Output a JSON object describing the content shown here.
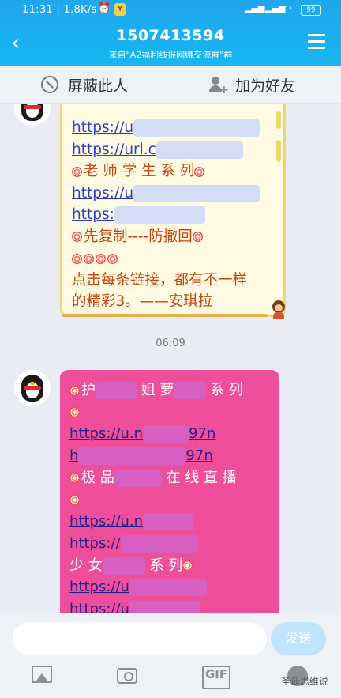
{
  "status_bar": {
    "time": "11:31",
    "speed": "1.8K/s",
    "alarm_icon": "alarm-icon",
    "network": "4G",
    "battery": "99"
  },
  "header": {
    "title": "1507413594",
    "subtitle": "来自\"A2福利线报网赚交流群\"群"
  },
  "actions": {
    "block_label": "屏蔽此人",
    "add_friend_label": "加为好友"
  },
  "message1": {
    "lines": [
      {
        "text": "https://u",
        "link": true
      },
      {
        "text": "https://url.c",
        "link": true
      },
      {
        "text": "老 师     学 生 系 列",
        "link": false
      },
      {
        "text": "https://u",
        "link": true
      },
      {
        "text": "https:",
        "link": true
      },
      {
        "text": "先复制----防撤回",
        "link": false
      },
      {
        "text": "点击每条链接，都有不一样",
        "link": false
      },
      {
        "text": "的精彩3。——安琪拉",
        "link": false
      }
    ]
  },
  "timestamp": "06:09",
  "message2": {
    "l1": "护",
    "l1b": "姐 萝",
    "l1c": "系 列",
    "l2": "https://u.n",
    "l2b": "97n",
    "l3": "h",
    "l3b": "97n",
    "l4": "极 品",
    "l4b": "在 线 直 播",
    "l5": "https://u.n",
    "l6": "https://",
    "l7": "少 女",
    "l7b": "系 列",
    "l8": "https://u",
    "l9": "https://u"
  },
  "input": {
    "placeholder": "",
    "send_label": "发送"
  },
  "tools": [
    "image-icon",
    "camera-icon",
    "gif-icon",
    "emoji-icon"
  ],
  "gif_label": "GIF",
  "watermark": "圣诞思维说"
}
